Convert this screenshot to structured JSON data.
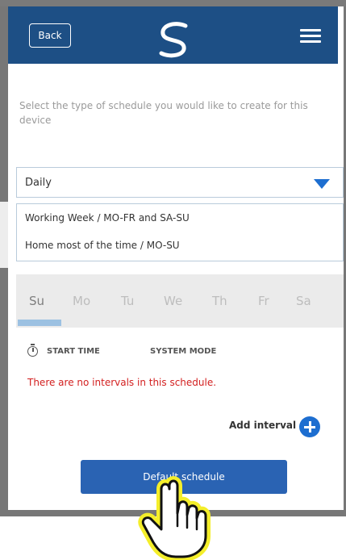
{
  "header": {
    "back_label": "Back",
    "logo": "brand-logo",
    "menu_icon": "hamburger-menu-icon"
  },
  "instruction": "Select the type of schedule you would like to create for this device",
  "schedule_select": {
    "selected": "Daily",
    "options": [
      "Working Week / MO-FR and SA-SU",
      "Home most of the time / MO-SU"
    ]
  },
  "days": [
    "Su",
    "Mo",
    "Tu",
    "We",
    "Th",
    "Fr",
    "Sa"
  ],
  "active_day": "Su",
  "columns": {
    "start_time": "START TIME",
    "system_mode": "SYSTEM MODE"
  },
  "empty_message": "There are no intervals in this schedule.",
  "add_interval_label": "Add interval",
  "default_schedule_label": "Default schedule",
  "colors": {
    "header": "#1d4f85",
    "accent": "#1d6ed0",
    "button": "#2a63b3",
    "error": "#d32020",
    "pointer_highlight": "#f4ee2a"
  }
}
